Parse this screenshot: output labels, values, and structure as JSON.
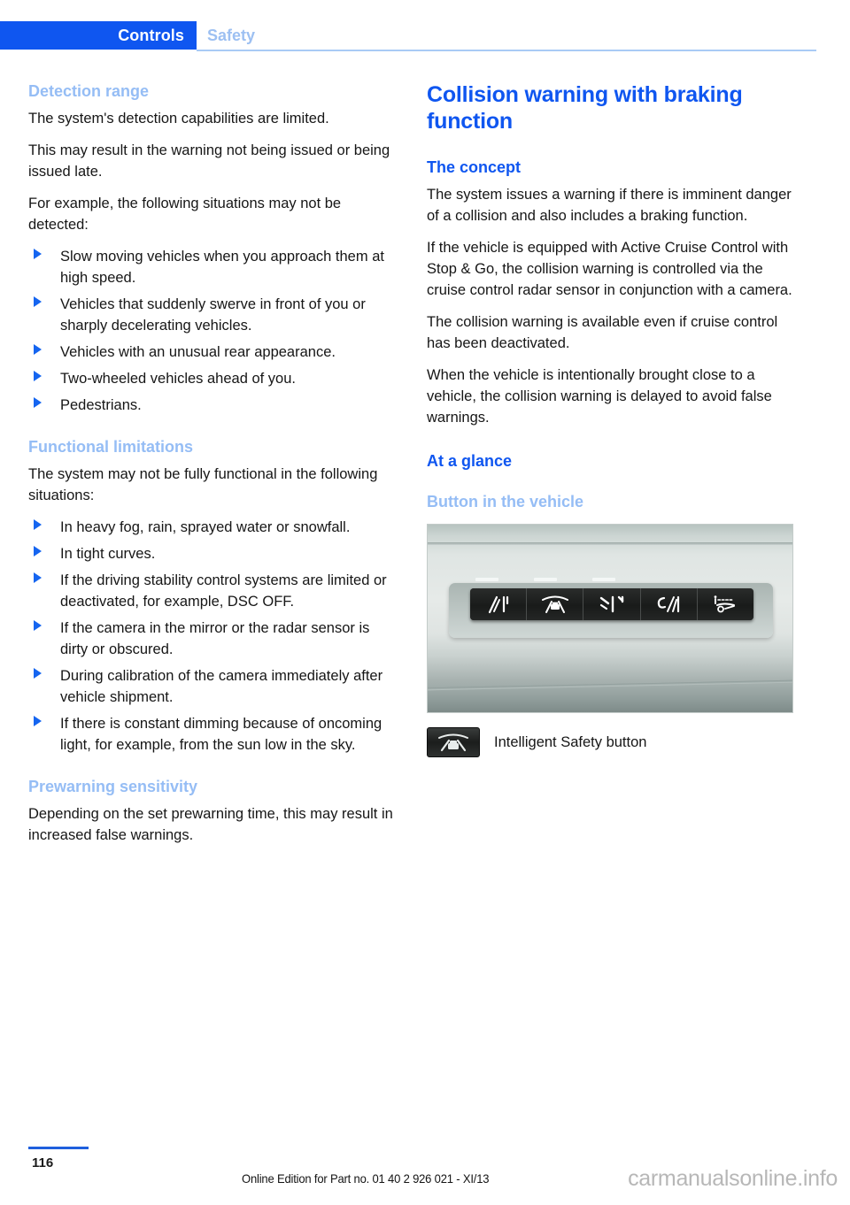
{
  "header": {
    "active_tab": "Controls",
    "inactive_tab": "Safety",
    "accent_color": "#0f56f0",
    "muted_accent_color": "#9dc0f2"
  },
  "left_column": {
    "section1": {
      "heading": "Detection range",
      "paragraphs": [
        "The system's detection capabilities are limited.",
        "This may result in the warning not being issued or being issued late.",
        "For example, the following situations may not be detected:"
      ],
      "bullets": [
        "Slow moving vehicles when you approach them at high speed.",
        "Vehicles that suddenly swerve in front of you or sharply decelerating vehicles.",
        "Vehicles with an unusual rear appearance.",
        "Two-wheeled vehicles ahead of you.",
        "Pedestrians."
      ]
    },
    "section2": {
      "heading": "Functional limitations",
      "paragraphs": [
        "The system may not be fully functional in the following situations:"
      ],
      "bullets": [
        "In heavy fog, rain, sprayed water or snowfall.",
        "In tight curves.",
        "If the driving stability control systems are limited or deactivated, for example, DSC OFF.",
        "If the camera in the mirror or the radar sensor is dirty or obscured.",
        "During calibration of the camera immediately after vehicle shipment.",
        "If there is constant dimming because of oncoming light, for example, from the sun low in the sky."
      ]
    },
    "section3": {
      "heading": "Prewarning sensitivity",
      "paragraphs": [
        "Depending on the set prewarning time, this may result in increased false warnings."
      ]
    }
  },
  "right_column": {
    "title": "Collision warning with braking function",
    "section1": {
      "heading": "The concept",
      "paragraphs": [
        "The system issues a warning if there is imminent danger of a collision and also includes a braking function.",
        "If the vehicle is equipped with Active Cruise Control with Stop & Go, the collision warning is controlled via the cruise control radar sensor in conjunction with a camera.",
        "The collision warning is available even if cruise control has been deactivated.",
        "When the vehicle is intentionally brought close to a vehicle, the collision warning is delayed to avoid false warnings."
      ]
    },
    "section2": {
      "heading": "At a glance",
      "subheading": "Button in the vehicle",
      "photo_alt": "vehicle-roof-console-buttons-photo",
      "buttons": [
        "lane-departure-warning-icon",
        "intelligent-safety-icon",
        "lane-change-warning-icon",
        "night-vision-icon",
        "parking-assistant-icon"
      ],
      "caption": "Intelligent Safety button",
      "caption_icon": "intelligent-safety-button-icon"
    }
  },
  "footer": {
    "page_number": "116",
    "edition": "Online Edition for Part no. 01 40 2 926 021 - XI/13",
    "watermark": "carmanualsonline.info",
    "rule_color": "#1f5fdd"
  }
}
